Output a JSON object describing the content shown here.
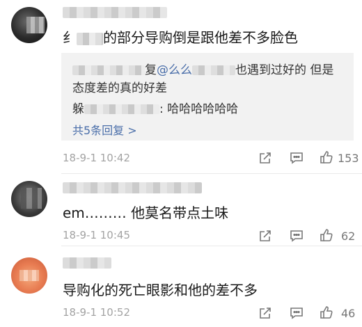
{
  "comments": [
    {
      "text": "的部分导购倒是跟他差不多脸色",
      "text_lead": "纟",
      "reply": {
        "line1_mid": "复",
        "line1_mention": "@么么",
        "line1_tail": "也遇到过好的 但是",
        "line2": "态度差的真的好差",
        "line3_lead": "躲",
        "line3_tail": ": 哈哈哈哈哈哈",
        "more": "共5条回复 >"
      },
      "timestamp": "18-9-1 10:42",
      "likes": "153"
    },
    {
      "text": "em……… 他莫名带点土味",
      "timestamp": "18-9-1 10:45",
      "likes": "62"
    },
    {
      "text": "导购化的死亡眼影和他的差不多",
      "timestamp": "18-9-1 10:52",
      "likes": "46"
    }
  ],
  "icons": {
    "share": "share-icon",
    "comment": "comment-icon",
    "like": "thumbs-up-icon"
  },
  "colors": {
    "link": "#4a6ea9",
    "meta": "#a3a3a3",
    "reply_bg": "#f2f2f2"
  }
}
